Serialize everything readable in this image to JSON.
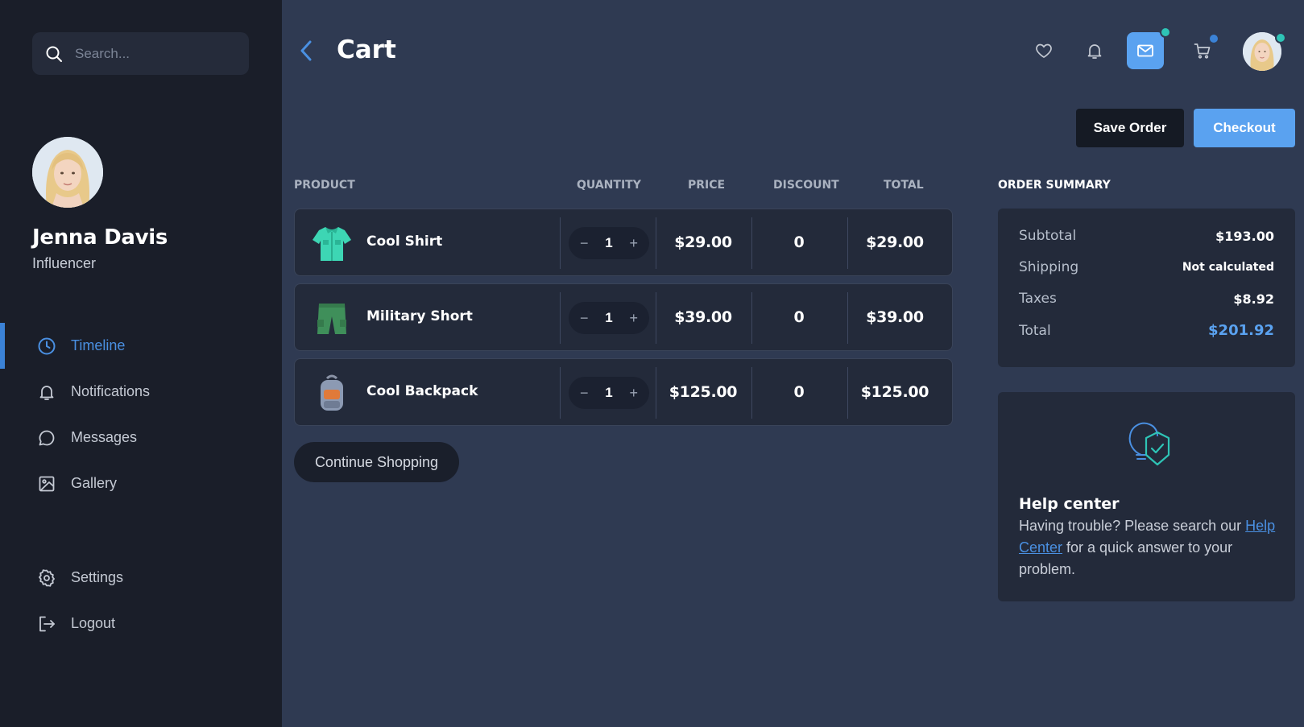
{
  "search": {
    "placeholder": "Search..."
  },
  "profile": {
    "name": "Jenna Davis",
    "role": "Influencer"
  },
  "nav": {
    "items": [
      {
        "label": "Timeline",
        "icon": "clock-icon",
        "active": true
      },
      {
        "label": "Notifications",
        "icon": "bell-icon"
      },
      {
        "label": "Messages",
        "icon": "chat-icon"
      },
      {
        "label": "Gallery",
        "icon": "image-icon"
      }
    ],
    "bottom": [
      {
        "label": "Settings",
        "icon": "gear-icon"
      },
      {
        "label": "Logout",
        "icon": "logout-icon"
      }
    ]
  },
  "header": {
    "title": "Cart",
    "icons": [
      "heart-icon",
      "bell-icon",
      "mail-icon",
      "cart-icon"
    ],
    "mail_badge_color": "#2ec4b6",
    "cart_badge_color": "#3b82d6"
  },
  "actions": {
    "save_label": "Save Order",
    "checkout_label": "Checkout"
  },
  "table": {
    "headers": [
      "PRODUCT",
      "QUANTITY",
      "PRICE",
      "DISCOUNT",
      "TOTAL"
    ],
    "rows": [
      {
        "name": "Cool Shirt",
        "quantity": "1",
        "price": "$29.00",
        "discount": "0",
        "total": "$29.00",
        "icon": "shirt-icon"
      },
      {
        "name": "Military Short",
        "quantity": "1",
        "price": "$39.00",
        "discount": "0",
        "total": "$39.00",
        "icon": "shorts-icon"
      },
      {
        "name": "Cool Backpack",
        "quantity": "1",
        "price": "$125.00",
        "discount": "0",
        "total": "$125.00",
        "icon": "backpack-icon"
      }
    ],
    "minus_symbol": "−",
    "plus_symbol": "+"
  },
  "continue_label": "Continue Shopping",
  "summary": {
    "title": "ORDER SUMMARY",
    "subtotal_label": "Subtotal",
    "subtotal": "$193.00",
    "shipping_label": "Shipping",
    "shipping": "Not calculated",
    "taxes_label": "Taxes",
    "taxes": "$8.92",
    "total_label": "Total",
    "total": "$201.92"
  },
  "help": {
    "title": "Help center",
    "text_before": "Having trouble? Please search our ",
    "link": "Help Center",
    "text_after": " for a quick answer to your problem."
  },
  "colors": {
    "accent": "#5aa2f0",
    "sidebar_bg": "#1a1e29",
    "main_bg": "#2f3a52",
    "card_bg": "#232a3a"
  }
}
